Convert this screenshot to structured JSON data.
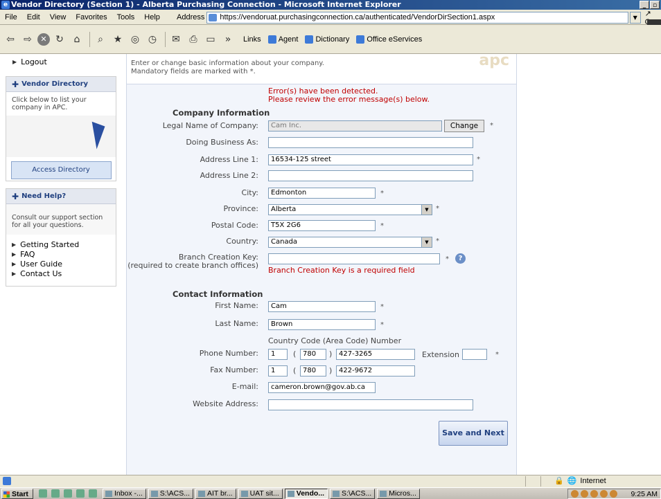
{
  "window": {
    "title": "Vendor Directory (Section 1) - Alberta Purchasing Connection - Microsoft Internet Explorer"
  },
  "menu": [
    "File",
    "Edit",
    "View",
    "Favorites",
    "Tools",
    "Help"
  ],
  "address": {
    "label": "Address",
    "url": "https://vendoruat.purchasingconnection.ca/authenticated/VendorDirSection1.aspx",
    "go": "Go"
  },
  "toolbar": {
    "chevron": "»",
    "links_label": "Links",
    "links": [
      "Agent",
      "Dictionary",
      "Office eServices"
    ]
  },
  "sidebar": {
    "logout": "Logout",
    "vendor_directory": {
      "title": "Vendor Directory",
      "text": "Click below to list your company in APC.",
      "button": "Access Directory"
    },
    "need_help": {
      "title": "Need Help?",
      "text": "Consult our support section for all your questions.",
      "links": [
        "Getting Started",
        "FAQ",
        "User Guide",
        "Contact Us"
      ]
    }
  },
  "content": {
    "intro": "Enter or change basic information about your company.\nMandatory fields are marked with *.",
    "logo": "apc",
    "errors": [
      "Error(s) have been detected.",
      "Please review the error message(s) below."
    ],
    "company_heading": "Company Information",
    "contact_heading": "Contact Information",
    "fields": {
      "legal_name": {
        "label": "Legal Name of Company:",
        "value": "Cam Inc.",
        "button": "Change"
      },
      "dba": {
        "label": "Doing Business As:",
        "value": ""
      },
      "address1": {
        "label": "Address Line 1:",
        "value": "16534-125 street"
      },
      "address2": {
        "label": "Address Line 2:",
        "value": ""
      },
      "city": {
        "label": "City:",
        "value": "Edmonton"
      },
      "province": {
        "label": "Province:",
        "value": "Alberta"
      },
      "postal": {
        "label": "Postal Code:",
        "value": "T5X 2G6"
      },
      "country": {
        "label": "Country:",
        "value": "Canada"
      },
      "branch_key": {
        "label": "Branch Creation Key:",
        "sublabel": "(required to create branch offices)",
        "value": "",
        "error": "Branch Creation Key is a required field"
      },
      "first_name": {
        "label": "First Name:",
        "value": "Cam"
      },
      "last_name": {
        "label": "Last Name:",
        "value": "Brown"
      },
      "phone_note": "Country Code (Area Code) Number",
      "phone": {
        "label": "Phone Number:",
        "country": "1",
        "area": "780",
        "number": "427-3265",
        "ext_label": "Extension",
        "ext": ""
      },
      "fax": {
        "label": "Fax Number:",
        "country": "1",
        "area": "780",
        "number": "422-9672"
      },
      "email": {
        "label": "E-mail:",
        "value": "cameron.brown@gov.ab.ca"
      },
      "website": {
        "label": "Website Address:",
        "value": ""
      }
    },
    "save_button": "Save and Next"
  },
  "status": {
    "zone": "Internet"
  },
  "taskbar": {
    "start": "Start",
    "tasks": [
      "Inbox -...",
      "S:\\ACS...",
      "AIT br...",
      "UAT sit...",
      "Vendo...",
      "S:\\ACS...",
      "Micros..."
    ],
    "active_index": 4,
    "clock": "9:25 AM"
  }
}
